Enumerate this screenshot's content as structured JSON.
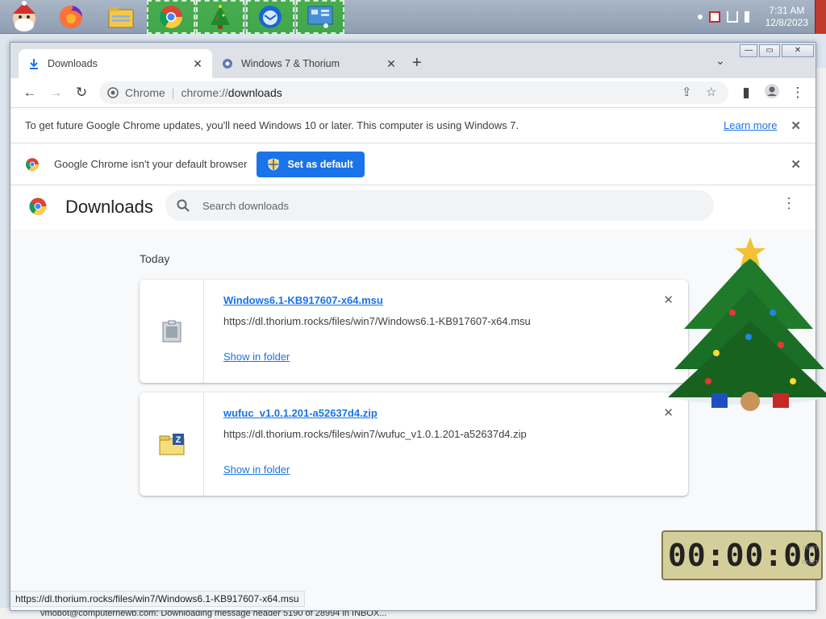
{
  "taskbar": {
    "clock_time": "7:31 AM",
    "clock_date": "12/8/2023"
  },
  "bg_window": {
    "status_text": "vmobot@computernewb.com: Downloading message header 5190 of 28994 in INBOX..."
  },
  "tabs": [
    {
      "label": "Downloads",
      "active": true
    },
    {
      "label": "Windows 7 & Thorium",
      "active": false
    }
  ],
  "omnibox": {
    "site": "Chrome",
    "scheme": "chrome://",
    "path": "downloads"
  },
  "update_bar": {
    "text": "To get future Google Chrome updates, you'll need Windows 10 or later. This computer is using Windows 7.",
    "link": "Learn more"
  },
  "default_bar": {
    "text": "Google Chrome isn't your default browser",
    "button": "Set as default"
  },
  "downloads": {
    "title": "Downloads",
    "search_placeholder": "Search downloads",
    "section": "Today",
    "items": [
      {
        "name": "Windows6.1-KB917607-x64.msu",
        "url": "https://dl.thorium.rocks/files/win7/Windows6.1-KB917607-x64.msu",
        "action": "Show in folder"
      },
      {
        "name": "wufuc_v1.0.1.201-a52637d4.zip",
        "url": "https://dl.thorium.rocks/files/win7/wufuc_v1.0.1.201-a52637d4.zip",
        "action": "Show in folder"
      }
    ]
  },
  "status_bubble": "https://dl.thorium.rocks/files/win7/Windows6.1-KB917607-x64.msu",
  "timer": {
    "display": "00:00:00"
  },
  "colors": {
    "accent": "#1a73e8",
    "taskbar_active": "#2aaa2a"
  }
}
